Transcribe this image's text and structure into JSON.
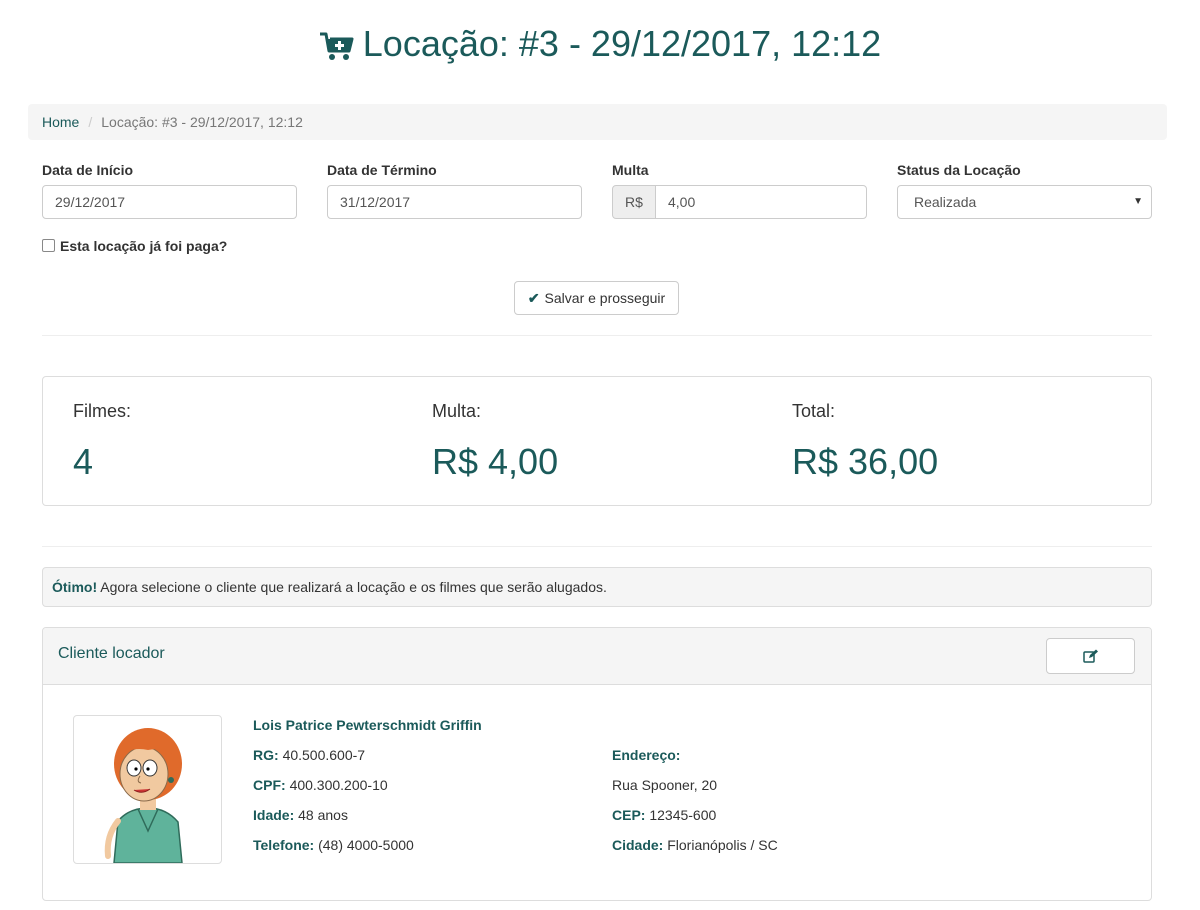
{
  "page": {
    "title": "Locação: #3 - 29/12/2017, 12:12"
  },
  "breadcrumb": {
    "home": "Home",
    "current": "Locação: #3 - 29/12/2017, 12:12"
  },
  "form": {
    "start_label": "Data de Início",
    "start_value": "29/12/2017",
    "end_label": "Data de Término",
    "end_value": "31/12/2017",
    "fine_label": "Multa",
    "fine_currency": "R$",
    "fine_value": "4,00",
    "status_label": "Status da Locação",
    "status_value": "Realizada",
    "paid_label": "Esta locação já foi paga?",
    "paid_checked": false,
    "save_label": "Salvar e prosseguir"
  },
  "stats": {
    "films_label": "Filmes:",
    "films_value": "4",
    "fine_label": "Multa:",
    "fine_value": "R$ 4,00",
    "total_label": "Total:",
    "total_value": "R$ 36,00"
  },
  "alert": {
    "strong": "Ótimo!",
    "text": " Agora selecione o cliente que realizará a locação e os filmes que serão alugados."
  },
  "client": {
    "panel_title": "Cliente locador",
    "name": "Lois Patrice Pewterschmidt Griffin",
    "rg_label": "RG:",
    "rg": "40.500.600-7",
    "cpf_label": "CPF:",
    "cpf": "400.300.200-10",
    "age_label": "Idade:",
    "age": "48 anos",
    "phone_label": "Telefone:",
    "phone": "(48) 4000-5000",
    "address_label": "Endereço:",
    "address": "Rua Spooner, 20",
    "cep_label": "CEP:",
    "cep": "12345-600",
    "city_label": "Cidade:",
    "city": "Florianópolis / SC"
  },
  "colors": {
    "accent": "#1b5a5a",
    "panel_bg": "#f5f5f5",
    "border": "#dddddd"
  },
  "icons": {
    "title": "cart-plus-icon",
    "save": "check-icon",
    "edit": "edit-icon",
    "select": "caret-down-icon"
  }
}
